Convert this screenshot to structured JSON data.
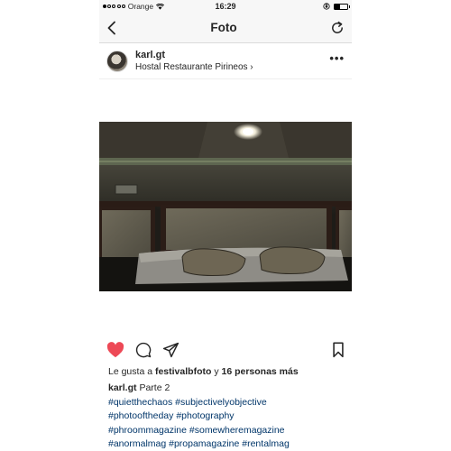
{
  "status": {
    "carrier": "Orange",
    "time": "16:29"
  },
  "nav": {
    "title": "Foto",
    "back_icon": "chevron-left-icon",
    "refresh_icon": "refresh-icon"
  },
  "post": {
    "username": "karl.gt",
    "location": "Hostal Restaurante Pirineos",
    "location_arrow": "›",
    "more": "•••"
  },
  "photo": {
    "icons": "hotel room photo with bed, pillows, ceiling light"
  },
  "actions": {
    "like_icon": "heart-icon",
    "comment_icon": "comment-icon",
    "share_icon": "send-icon",
    "save_icon": "bookmark-icon",
    "liked_color": "#ed4956"
  },
  "likes": {
    "prefix": "Le gusta a",
    "user": "festivalbfoto",
    "connector": "y",
    "count": "16 personas más"
  },
  "caption": {
    "username": "karl.gt",
    "text": "Parte 2",
    "tags_line1": "#quietthechaos #subjectivelyobjective",
    "tags_line2": "#photooftheday #photography",
    "tags_line3": "#phroommagazine #somewheremagazine",
    "tags_line4": "#anormalmag #propamagazine #rentalmag"
  }
}
